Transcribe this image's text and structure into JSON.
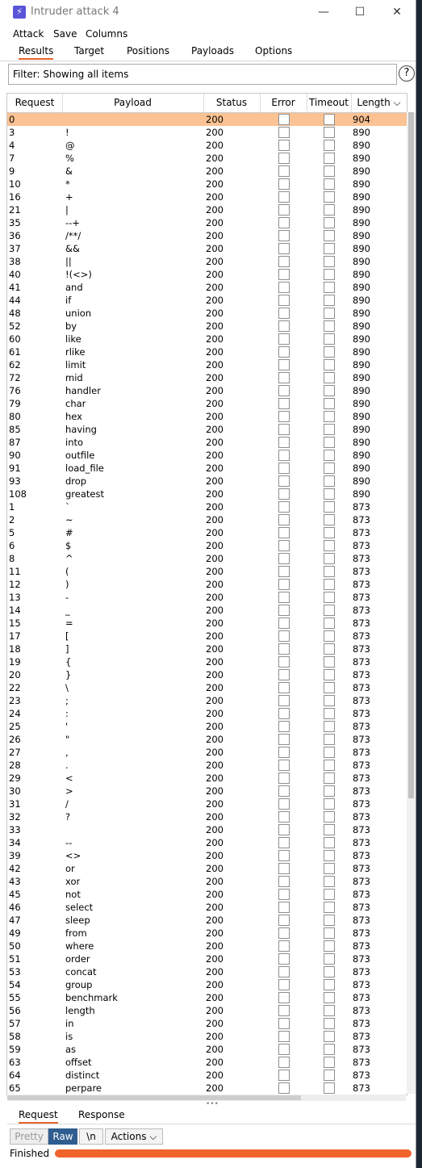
{
  "window": {
    "title": "Intruder attack 4",
    "app_icon": "burp-lightning-icon",
    "controls": {
      "minimize": "—",
      "maximize": "☐",
      "close": "✕"
    }
  },
  "menu": {
    "items": [
      "Attack",
      "Save",
      "Columns"
    ]
  },
  "tabs": {
    "items": [
      "Results",
      "Target",
      "Positions",
      "Payloads",
      "Options"
    ],
    "active": "Results"
  },
  "filter": {
    "text": "Filter: Showing all items",
    "help": "?"
  },
  "table": {
    "columns": [
      "Request",
      "Payload",
      "Status",
      "Error",
      "Timeout",
      "Length ⌵"
    ],
    "selected_index": 0,
    "rows": [
      [
        "0",
        "",
        "200",
        "904"
      ],
      [
        "3",
        "!",
        "200",
        "890"
      ],
      [
        "4",
        "@",
        "200",
        "890"
      ],
      [
        "7",
        "%",
        "200",
        "890"
      ],
      [
        "9",
        "&",
        "200",
        "890"
      ],
      [
        "10",
        "*",
        "200",
        "890"
      ],
      [
        "16",
        "+",
        "200",
        "890"
      ],
      [
        "21",
        "|",
        "200",
        "890"
      ],
      [
        "35",
        "--+",
        "200",
        "890"
      ],
      [
        "36",
        "/**/",
        "200",
        "890"
      ],
      [
        "37",
        "&&",
        "200",
        "890"
      ],
      [
        "38",
        "||",
        "200",
        "890"
      ],
      [
        "40",
        "!(<>)",
        "200",
        "890"
      ],
      [
        "41",
        "and",
        "200",
        "890"
      ],
      [
        "44",
        "if",
        "200",
        "890"
      ],
      [
        "48",
        "union",
        "200",
        "890"
      ],
      [
        "52",
        "by",
        "200",
        "890"
      ],
      [
        "60",
        "like",
        "200",
        "890"
      ],
      [
        "61",
        "rlike",
        "200",
        "890"
      ],
      [
        "62",
        "limit",
        "200",
        "890"
      ],
      [
        "72",
        "mid",
        "200",
        "890"
      ],
      [
        "76",
        "handler",
        "200",
        "890"
      ],
      [
        "79",
        "char",
        "200",
        "890"
      ],
      [
        "80",
        "hex",
        "200",
        "890"
      ],
      [
        "85",
        "having",
        "200",
        "890"
      ],
      [
        "87",
        "into",
        "200",
        "890"
      ],
      [
        "90",
        "outfile",
        "200",
        "890"
      ],
      [
        "91",
        "load_file",
        "200",
        "890"
      ],
      [
        "93",
        "drop",
        "200",
        "890"
      ],
      [
        "108",
        "greatest",
        "200",
        "890"
      ],
      [
        "1",
        "`",
        "200",
        "873"
      ],
      [
        "2",
        "~",
        "200",
        "873"
      ],
      [
        "5",
        "#",
        "200",
        "873"
      ],
      [
        "6",
        "$",
        "200",
        "873"
      ],
      [
        "8",
        "^",
        "200",
        "873"
      ],
      [
        "11",
        "(",
        "200",
        "873"
      ],
      [
        "12",
        ")",
        "200",
        "873"
      ],
      [
        "13",
        "-",
        "200",
        "873"
      ],
      [
        "14",
        "_",
        "200",
        "873"
      ],
      [
        "15",
        "=",
        "200",
        "873"
      ],
      [
        "17",
        "[",
        "200",
        "873"
      ],
      [
        "18",
        "]",
        "200",
        "873"
      ],
      [
        "19",
        "{",
        "200",
        "873"
      ],
      [
        "20",
        "}",
        "200",
        "873"
      ],
      [
        "22",
        "\\",
        "200",
        "873"
      ],
      [
        "23",
        ";",
        "200",
        "873"
      ],
      [
        "24",
        ":",
        "200",
        "873"
      ],
      [
        "25",
        "'",
        "200",
        "873"
      ],
      [
        "26",
        "\"",
        "200",
        "873"
      ],
      [
        "27",
        ",",
        "200",
        "873"
      ],
      [
        "28",
        ".",
        "200",
        "873"
      ],
      [
        "29",
        "<",
        "200",
        "873"
      ],
      [
        "30",
        ">",
        "200",
        "873"
      ],
      [
        "31",
        "/",
        "200",
        "873"
      ],
      [
        "32",
        "?",
        "200",
        "873"
      ],
      [
        "33",
        "",
        "200",
        "873"
      ],
      [
        "34",
        "--",
        "200",
        "873"
      ],
      [
        "39",
        "<>",
        "200",
        "873"
      ],
      [
        "42",
        "or",
        "200",
        "873"
      ],
      [
        "43",
        "xor",
        "200",
        "873"
      ],
      [
        "45",
        "not",
        "200",
        "873"
      ],
      [
        "46",
        "select",
        "200",
        "873"
      ],
      [
        "47",
        "sleep",
        "200",
        "873"
      ],
      [
        "49",
        "from",
        "200",
        "873"
      ],
      [
        "50",
        "where",
        "200",
        "873"
      ],
      [
        "51",
        "order",
        "200",
        "873"
      ],
      [
        "53",
        "concat",
        "200",
        "873"
      ],
      [
        "54",
        "group",
        "200",
        "873"
      ],
      [
        "55",
        "benchmark",
        "200",
        "873"
      ],
      [
        "56",
        "length",
        "200",
        "873"
      ],
      [
        "57",
        "in",
        "200",
        "873"
      ],
      [
        "58",
        "is",
        "200",
        "873"
      ],
      [
        "59",
        "as",
        "200",
        "873"
      ],
      [
        "63",
        "offset",
        "200",
        "873"
      ],
      [
        "64",
        "distinct",
        "200",
        "873"
      ],
      [
        "65",
        "perpare",
        "200",
        "873"
      ]
    ]
  },
  "bottom_tabs": {
    "items": [
      "Request",
      "Response"
    ],
    "active": "Request"
  },
  "toolbar": {
    "pretty": "Pretty",
    "raw": "Raw",
    "newline": "\\n",
    "actions": "Actions ⌵"
  },
  "status": {
    "text": "Finished",
    "progress": 1.0
  },
  "colors": {
    "accent": "#e8622c",
    "selected_row": "#fbc293",
    "raw_button": "#2f5d8f",
    "progress": "#f0642c"
  }
}
